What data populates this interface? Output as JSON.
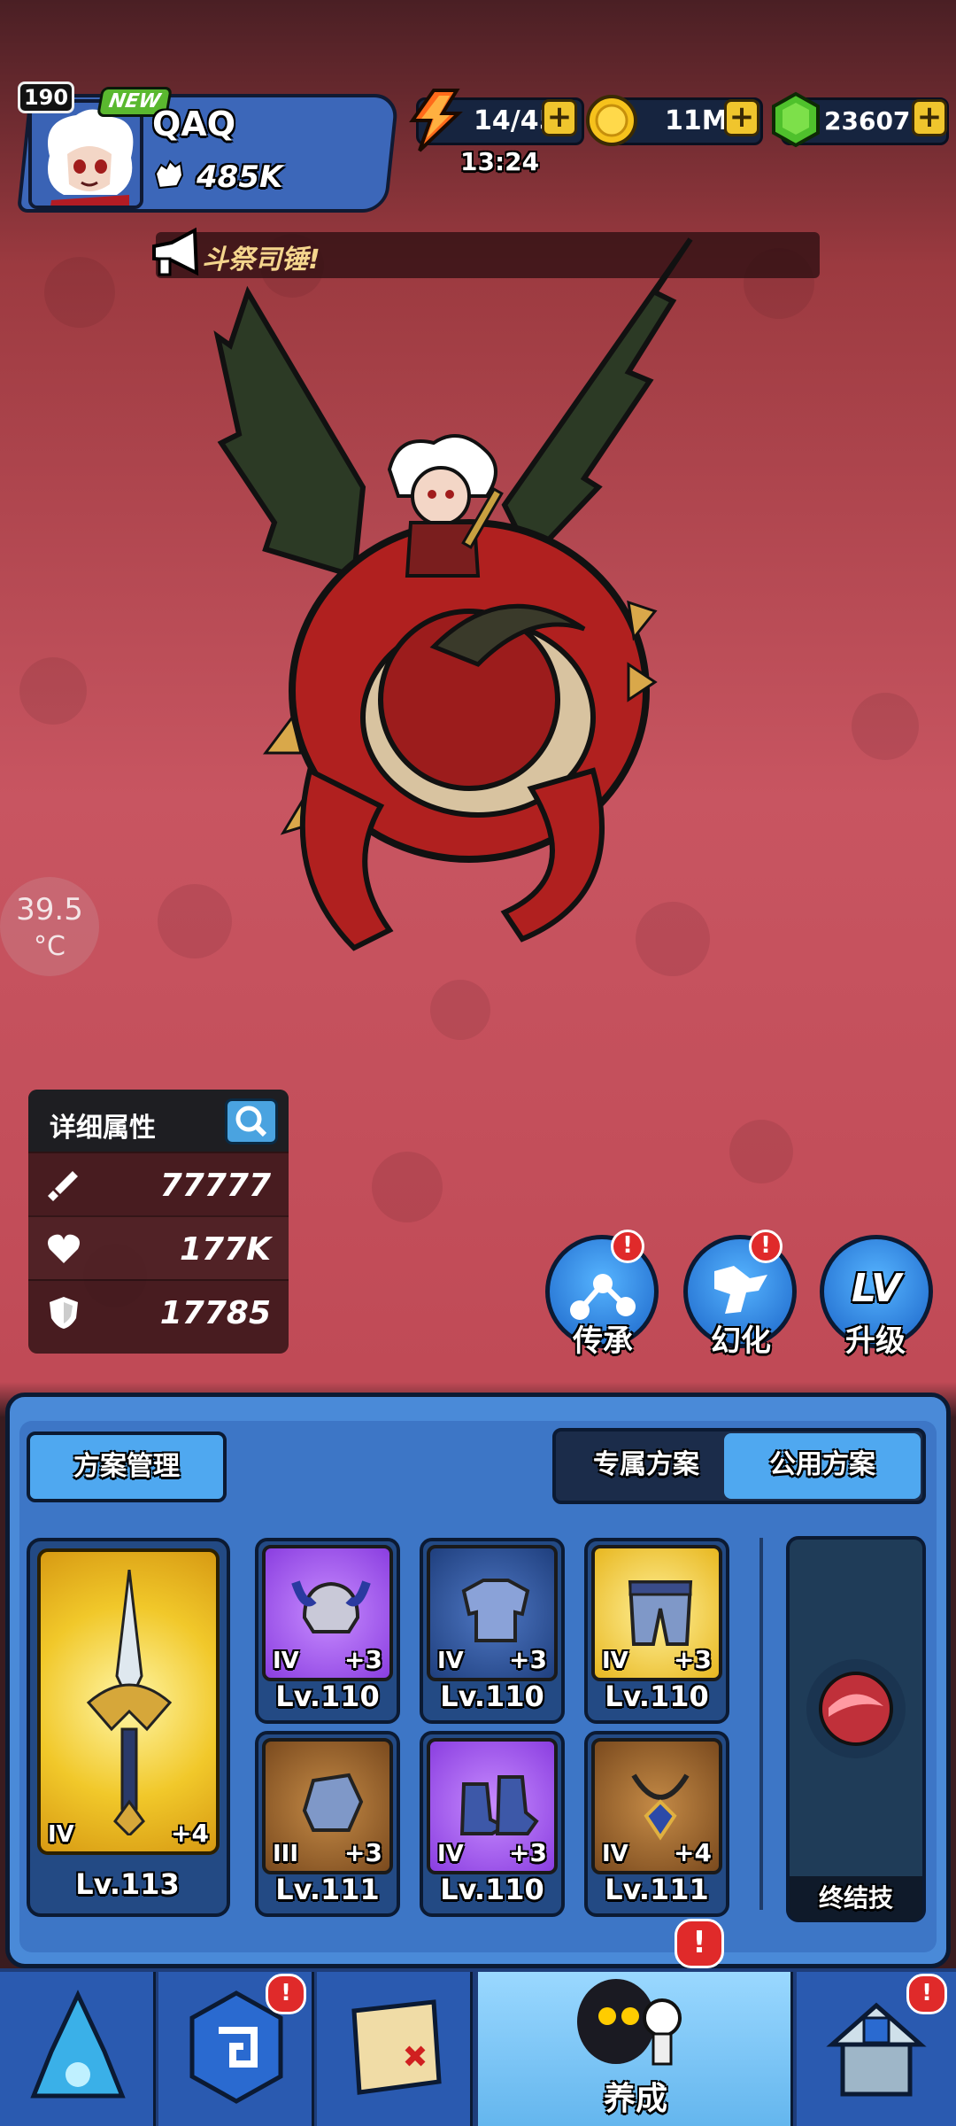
{
  "player": {
    "level": "190",
    "new_badge": "NEW",
    "name": "QAQ",
    "power": "485K"
  },
  "resources": {
    "energy": "14/45",
    "energy_timer": "13:24",
    "gold": "11M",
    "gems": "23607",
    "plus": "+"
  },
  "announcement": {
    "text": "斗祭司锤!"
  },
  "temperature": {
    "value": "39.5",
    "unit": "°C"
  },
  "stats": {
    "title": "详细属性",
    "attack": "77777",
    "health": "177K",
    "defense": "17785"
  },
  "actions": [
    {
      "label": "传承",
      "badge": "!"
    },
    {
      "label": "幻化",
      "badge": "!"
    },
    {
      "label": "升级",
      "icon_text": "LV"
    }
  ],
  "panel": {
    "scheme_manage": "方案管理",
    "tab_exclusive": "专属方案",
    "tab_public": "公用方案",
    "ultimate": "终结技"
  },
  "weapon": {
    "tier": "IV",
    "plus": "+4",
    "level": "Lv.113"
  },
  "equipment": [
    {
      "tier": "IV",
      "plus": "+3",
      "level": "Lv.110",
      "rarity": "purple"
    },
    {
      "tier": "IV",
      "plus": "+3",
      "level": "Lv.110",
      "rarity": "blue"
    },
    {
      "tier": "IV",
      "plus": "+3",
      "level": "Lv.110",
      "rarity": "gold"
    },
    {
      "tier": "III",
      "plus": "+3",
      "level": "Lv.111",
      "rarity": "brown"
    },
    {
      "tier": "IV",
      "plus": "+3",
      "level": "Lv.110",
      "rarity": "purple"
    },
    {
      "tier": "IV",
      "plus": "+4",
      "level": "Lv.111",
      "rarity": "brown"
    }
  ],
  "nav": {
    "active_label": "养成",
    "badge": "!"
  }
}
